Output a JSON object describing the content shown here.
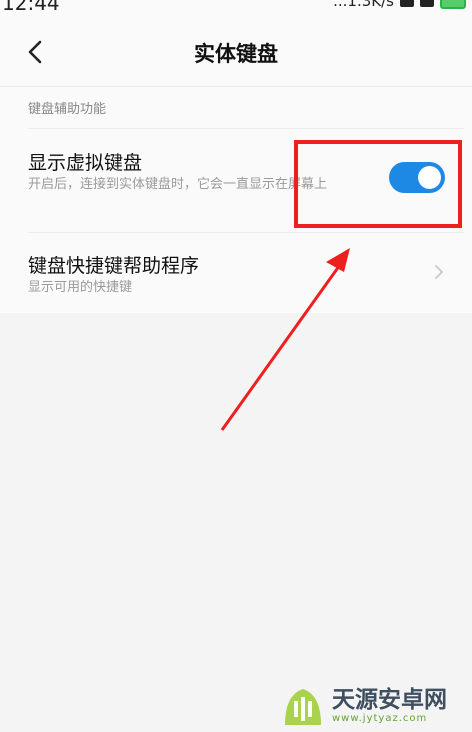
{
  "status_bar": {
    "time": "12:44",
    "speed": "...1.3K/s"
  },
  "header": {
    "title": "实体键盘"
  },
  "section": {
    "label": "键盘辅助功能"
  },
  "rows": [
    {
      "title": "显示虚拟键盘",
      "description": "开启后，连接到实体键盘时，它会一直显示在屏幕上",
      "toggle_on": true
    },
    {
      "title": "键盘快捷键帮助程序",
      "description": "显示可用的快捷键"
    }
  ],
  "colors": {
    "toggle": "#1e88e5",
    "annotation": "#ee1f1f"
  },
  "watermark": {
    "main": "天源安卓网",
    "sub": "www.jytyaz.com"
  }
}
